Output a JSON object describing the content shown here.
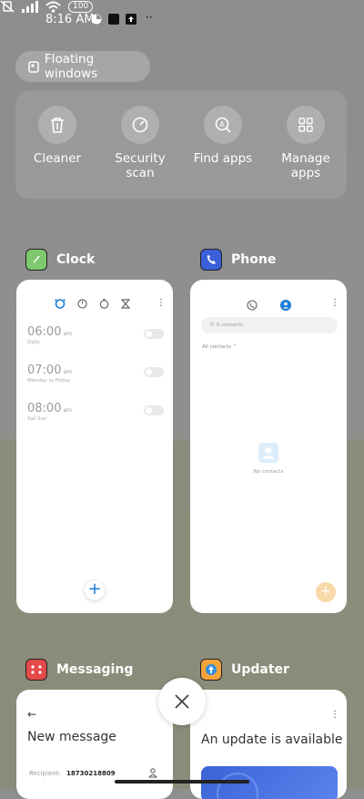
{
  "status_bar": {
    "time": "8:16 AM",
    "battery": "100"
  },
  "floating_windows": {
    "label": "Floating windows"
  },
  "tools": [
    {
      "label": "Cleaner",
      "icon": "trash-icon"
    },
    {
      "label": "Security\nscan",
      "icon": "security-scan-icon"
    },
    {
      "label": "Find apps",
      "icon": "find-apps-icon"
    },
    {
      "label": "Manage\napps",
      "icon": "grid-icon"
    }
  ],
  "apps": {
    "clock": {
      "name": "Clock",
      "alarms": [
        {
          "time": "06:00",
          "ampm": "am",
          "sub": "Daily"
        },
        {
          "time": "07:00",
          "ampm": "am",
          "sub": "Monday to Friday"
        },
        {
          "time": "08:00",
          "ampm": "am",
          "sub": "Sat-Sun"
        }
      ]
    },
    "phone": {
      "name": "Phone",
      "search_placeholder": "0 contacts",
      "filter": "All contacts",
      "empty": "No contacts"
    },
    "messaging": {
      "name": "Messaging",
      "title": "New message",
      "recipient_label": "Recipient:",
      "recipient_value": "18730218809"
    },
    "updater": {
      "name": "Updater",
      "title": "An update is available"
    }
  },
  "colors": {
    "accent_blue": "#1d7dd6",
    "clock_icon": "#7ec86f",
    "phone_icon": "#3a5fd8",
    "messaging_icon": "#e54a4a",
    "updater_icon": "#f5a43c"
  }
}
